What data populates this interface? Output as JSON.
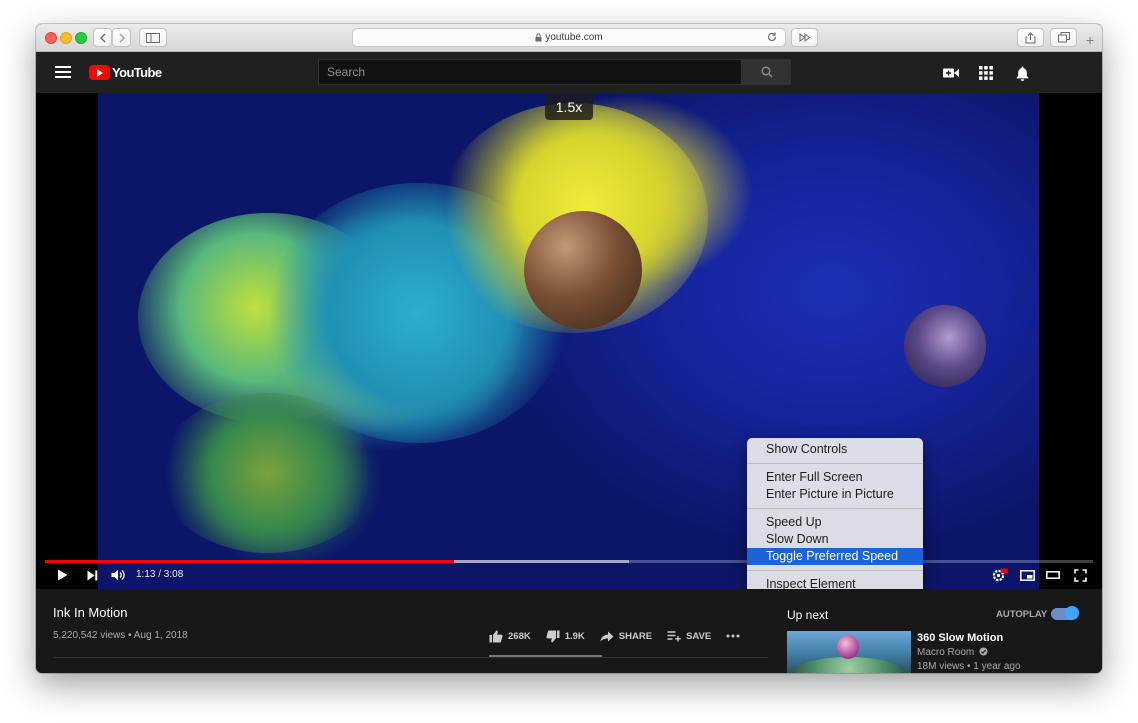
{
  "browser": {
    "url": "youtube.com",
    "lock_icon": "lock-icon",
    "reload_icon": "reload-icon"
  },
  "header": {
    "logo_text": "YouTube",
    "search_placeholder": "Search",
    "icons": [
      "menu-icon",
      "create-video-icon",
      "apps-grid-icon",
      "notifications-bell-icon"
    ]
  },
  "player": {
    "speed_badge": "1.5x",
    "time": "1:13 / 3:08",
    "progress_played": 0.39,
    "progress_buffered": 0.557,
    "accent_color": "#ff0000"
  },
  "context_menu": {
    "items": [
      "Show Controls",
      "Enter Full Screen",
      "Enter Picture in Picture",
      "Speed Up",
      "Slow Down",
      "Toggle Preferred Speed",
      "Inspect Element"
    ],
    "highlight_color": "#1c63d9"
  },
  "video_info": {
    "title": "Ink In Motion",
    "meta": "5,220,542 views • Aug 1, 2018",
    "likes": "268K",
    "dislikes": "1.9K",
    "share_label": "SHARE",
    "save_label": "SAVE"
  },
  "sidebar": {
    "up_next_label": "Up next",
    "autoplay_label": "AUTOPLAY",
    "autoplay_on": true,
    "recommendation": {
      "title": "360 Slow Motion",
      "channel": "Macro Room",
      "meta": "18M views • 1 year ago"
    }
  }
}
